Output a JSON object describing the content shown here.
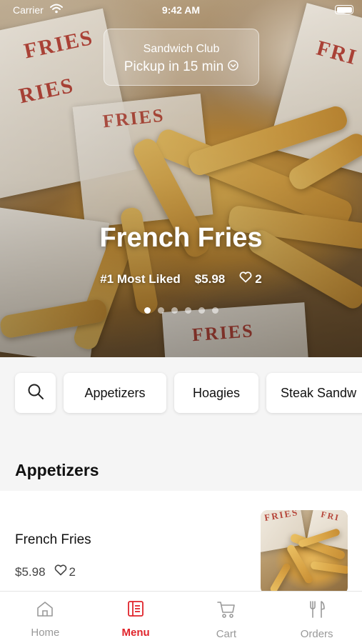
{
  "status_bar": {
    "carrier": "Carrier",
    "time": "9:42 AM"
  },
  "store": {
    "name": "Sandwich Club",
    "pickup": "Pickup in 15 min"
  },
  "hero": {
    "title": "French Fries",
    "badge": "#1 Most Liked",
    "price": "$5.98",
    "likes": "2",
    "page_count": 6,
    "active_page": 0
  },
  "categories": [
    "Appetizers",
    "Hoagies",
    "Steak Sandw"
  ],
  "section": {
    "title": "Appetizers"
  },
  "item": {
    "name": "French Fries",
    "price": "$5.98",
    "likes": "2"
  },
  "tabs": [
    {
      "label": "Home",
      "icon": "home-icon",
      "active": false
    },
    {
      "label": "Menu",
      "icon": "menu-icon",
      "active": true
    },
    {
      "label": "Cart",
      "icon": "cart-icon",
      "active": false
    },
    {
      "label": "Orders",
      "icon": "orders-icon",
      "active": false
    }
  ],
  "colors": {
    "accent": "#e0242b",
    "inactive_tab": "#999999"
  }
}
